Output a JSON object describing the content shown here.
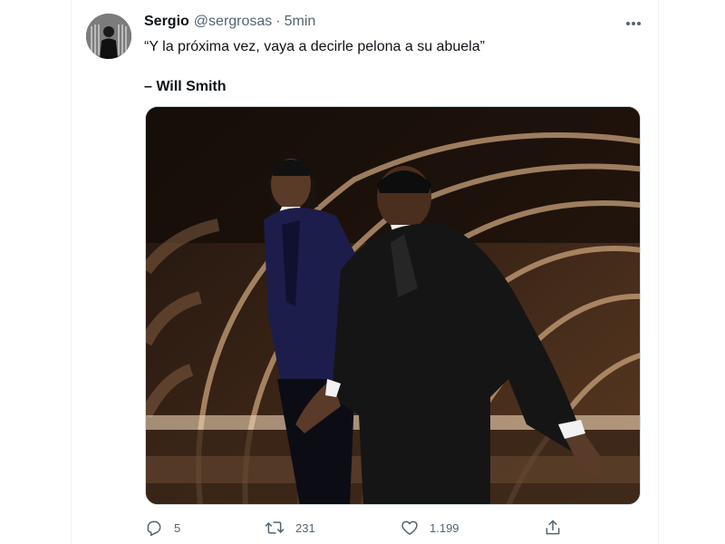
{
  "tweet": {
    "author_name": "Sergio",
    "author_handle": "@sergrosas",
    "separator": "·",
    "time": "5min",
    "quote": "“Y la próxima vez, vaya a decirle pelona a su abuela”",
    "attribution": "– Will Smith"
  },
  "actions": {
    "replies": "5",
    "retweets": "231",
    "likes": "1.199"
  },
  "icons": {
    "more": "more-horizontal-icon",
    "reply": "reply-icon",
    "retweet": "retweet-icon",
    "like": "heart-icon",
    "share": "share-icon"
  },
  "colors": {
    "text_primary": "#0f1419",
    "text_secondary": "#536471",
    "border": "#cfd9de"
  }
}
